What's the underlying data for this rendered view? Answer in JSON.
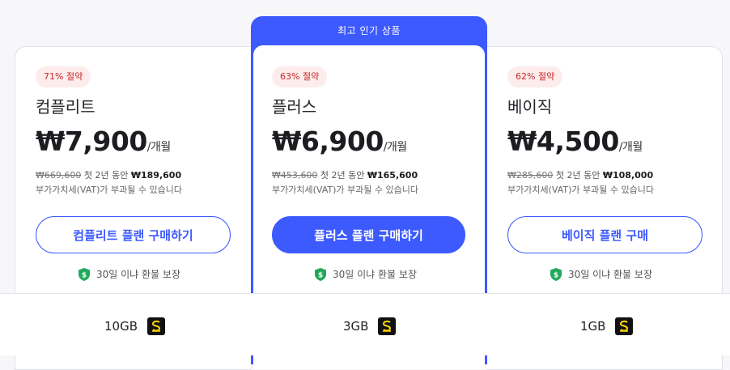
{
  "featured_banner": "최고 인기 상품",
  "accent_color": "#3d5afe",
  "badge_color": "#c62828",
  "plans": [
    {
      "badge": "71% 절약",
      "name": "컴플리트",
      "price": "₩7,900",
      "per": "/개월",
      "original_price": "₩669,600",
      "promo_text": "첫 2년 동안",
      "promo_price": "₩189,600",
      "vat": "부가가치세(VAT)가 부과될 수 있습니다",
      "button": "컴플리트 플랜 구매하기",
      "guarantee": "30일 이냐 환불 보장",
      "storage": "10GB",
      "storage_icon": "storage-badge-icon"
    },
    {
      "badge": "63% 절약",
      "name": "플러스",
      "price": "₩6,900",
      "per": "/개월",
      "original_price": "₩453,600",
      "promo_text": "첫 2년 동안",
      "promo_price": "₩165,600",
      "vat": "부가가치세(VAT)가 부과될 수 있습니다",
      "button": "플러스 플랜 구매하기",
      "guarantee": "30일 이냐 환불 보장",
      "storage": "3GB",
      "storage_icon": "storage-badge-icon"
    },
    {
      "badge": "62% 절약",
      "name": "베이직",
      "price": "₩4,500",
      "per": "/개월",
      "original_price": "₩285,600",
      "promo_text": "첫 2년 동안",
      "promo_price": "₩108,000",
      "vat": "부가가치세(VAT)가 부과될 수 있습니다",
      "button": "베이직 플랜 구매",
      "guarantee": "30일 이냐 환불 보장",
      "storage": "1GB",
      "storage_icon": "storage-badge-icon"
    }
  ]
}
